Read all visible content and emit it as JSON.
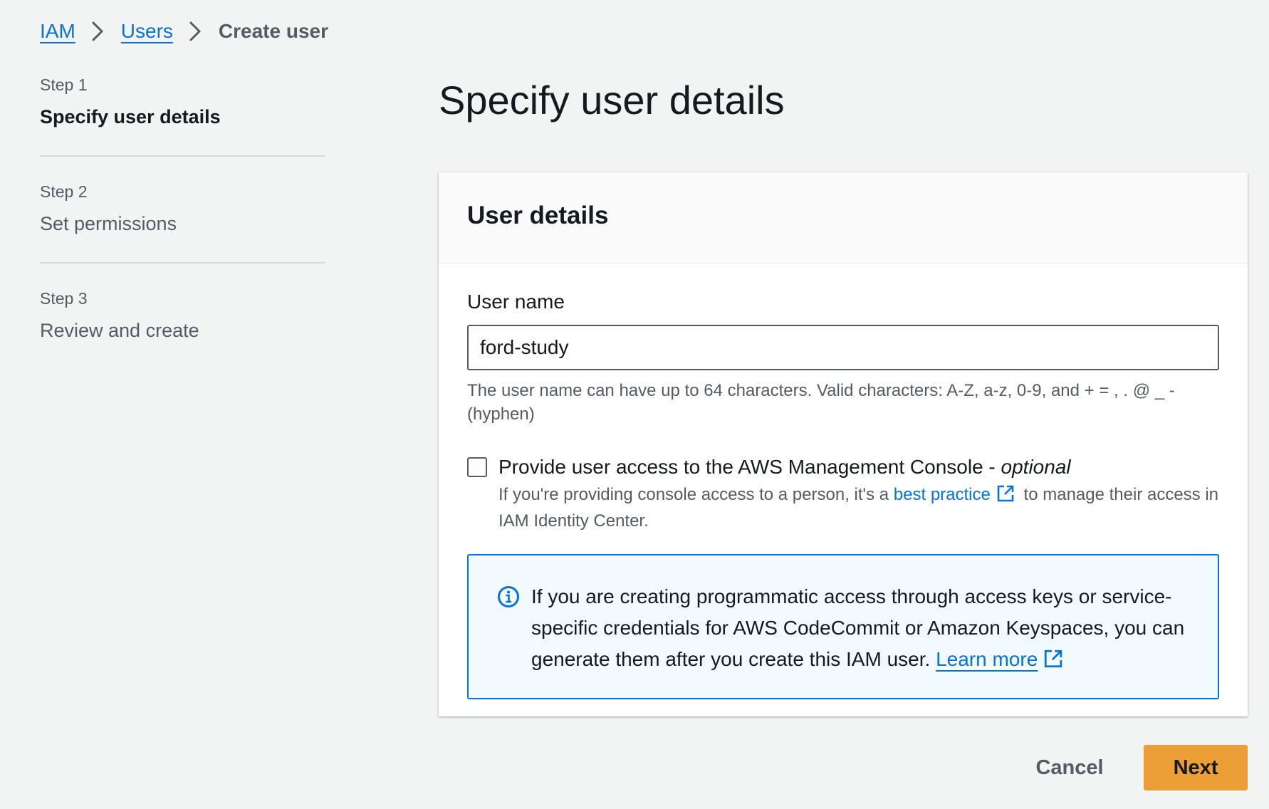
{
  "breadcrumb": {
    "items": [
      "IAM",
      "Users"
    ],
    "current": "Create user"
  },
  "steps": [
    {
      "number": "Step 1",
      "title": "Specify user details",
      "active": true
    },
    {
      "number": "Step 2",
      "title": "Set permissions",
      "active": false
    },
    {
      "number": "Step 3",
      "title": "Review and create",
      "active": false
    }
  ],
  "page": {
    "title": "Specify user details"
  },
  "card": {
    "title": "User details",
    "username": {
      "label": "User name",
      "value": "ford-study",
      "hint": "The user name can have up to 64 characters. Valid characters: A-Z, a-z, 0-9, and + = , . @ _ - (hyphen)"
    },
    "console_access": {
      "label": "Provide user access to the AWS Management Console - ",
      "label_optional": "optional",
      "checked": false,
      "desc_before": "If you're providing console access to a person, it's a ",
      "desc_link": "best practice",
      "desc_after": " to manage their access in IAM Identity Center."
    },
    "info_alert": {
      "text": "If you are creating programmatic access through access keys or service-specific credentials for AWS CodeCommit or Amazon Keyspaces, you can generate them after you create this IAM user. ",
      "link": "Learn more"
    }
  },
  "actions": {
    "cancel": "Cancel",
    "next": "Next"
  },
  "icons": {
    "breadcrumb_separator": "chevron-right-icon",
    "external_link": "external-link-icon",
    "info": "info-circle-icon"
  },
  "colors": {
    "link": "#0972d3",
    "primary_button": "#ec9f36",
    "info_background": "#f1faff",
    "page_background": "#f2f3f3"
  }
}
